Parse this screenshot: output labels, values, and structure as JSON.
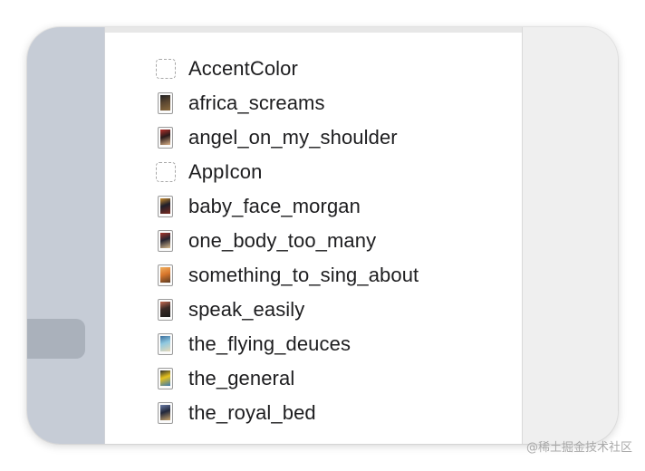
{
  "assets": [
    {
      "name": "AccentColor",
      "kind": "color-set"
    },
    {
      "name": "africa_screams",
      "kind": "image",
      "colors": [
        "#5a4630",
        "#1e1e22",
        "#8a6a3e"
      ]
    },
    {
      "name": "angel_on_my_shoulder",
      "kind": "image",
      "colors": [
        "#2a1a1a",
        "#b8322c",
        "#dcb38a"
      ]
    },
    {
      "name": "AppIcon",
      "kind": "app-icon"
    },
    {
      "name": "baby_face_morgan",
      "kind": "image",
      "colors": [
        "#1f1f2a",
        "#c98b2e",
        "#7a2a20"
      ]
    },
    {
      "name": "one_body_too_many",
      "kind": "image",
      "colors": [
        "#262430",
        "#a8362c",
        "#d9bc90"
      ]
    },
    {
      "name": "something_to_sing_about",
      "kind": "image",
      "colors": [
        "#d9772c",
        "#f0b060",
        "#5a3a22"
      ]
    },
    {
      "name": "speak_easily",
      "kind": "image",
      "colors": [
        "#3a2a26",
        "#c46a52",
        "#1a1a1a"
      ]
    },
    {
      "name": "the_flying_deuces",
      "kind": "image",
      "colors": [
        "#8fc8e0",
        "#3a6e9c",
        "#e6d9b8"
      ]
    },
    {
      "name": "the_general",
      "kind": "image",
      "colors": [
        "#e6c21e",
        "#2e2e2e",
        "#3a7ab0"
      ]
    },
    {
      "name": "the_royal_bed",
      "kind": "image",
      "colors": [
        "#22283c",
        "#6b7ea8",
        "#c6a26a"
      ]
    }
  ],
  "watermark": "@稀土掘金技术社区",
  "theme": {
    "sidebar": "#c6ccd6",
    "sidebar_selection": "#aab1bb",
    "panel": "#ffffff",
    "inspector": "#efefef",
    "text": "#1d1d1f"
  }
}
